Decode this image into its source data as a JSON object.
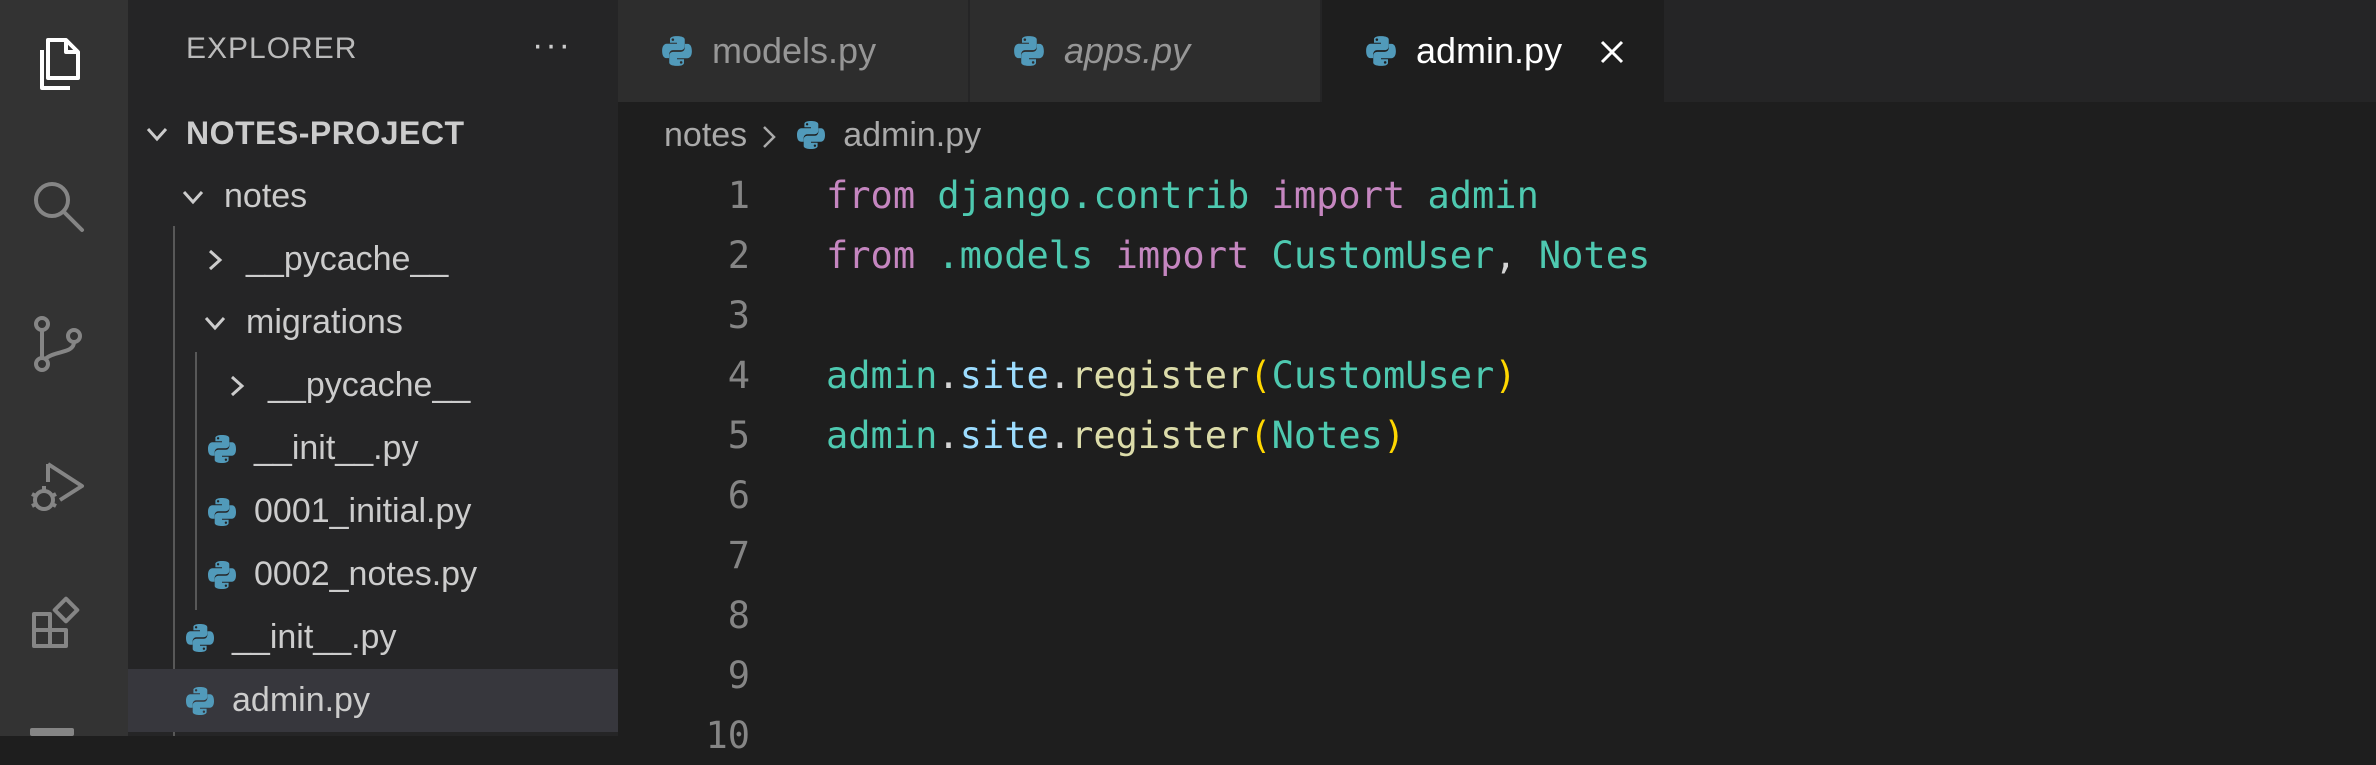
{
  "explorer": {
    "header": "EXPLORER",
    "more": "···",
    "project": "NOTES-PROJECT",
    "tree": [
      {
        "label": "notes",
        "type": "folder",
        "open": true,
        "depth": 1
      },
      {
        "label": "__pycache__",
        "type": "folder",
        "open": false,
        "depth": 2
      },
      {
        "label": "migrations",
        "type": "folder",
        "open": true,
        "depth": 2
      },
      {
        "label": "__pycache__",
        "type": "folder",
        "open": false,
        "depth": 3
      },
      {
        "label": "__init__.py",
        "type": "py",
        "depth": 3
      },
      {
        "label": "0001_initial.py",
        "type": "py",
        "depth": 3
      },
      {
        "label": "0002_notes.py",
        "type": "py",
        "depth": 3
      },
      {
        "label": "__init__.py",
        "type": "py",
        "depth": 2
      },
      {
        "label": "admin.py",
        "type": "py",
        "depth": 2,
        "selected": true
      }
    ]
  },
  "tabs": [
    {
      "label": "models.py",
      "active": false,
      "italic": false
    },
    {
      "label": "apps.py",
      "active": false,
      "italic": true
    },
    {
      "label": "admin.py",
      "active": true,
      "italic": false
    }
  ],
  "breadcrumb": {
    "folder": "notes",
    "file": "admin.py"
  },
  "code": {
    "line_numbers": [
      "1",
      "2",
      "3",
      "4",
      "5",
      "6",
      "7",
      "8",
      "9",
      "10"
    ],
    "lines": [
      [
        {
          "t": "from",
          "c": "kw"
        },
        {
          "t": " ",
          "c": "punct"
        },
        {
          "t": "django.contrib",
          "c": "mod"
        },
        {
          "t": " ",
          "c": "punct"
        },
        {
          "t": "import",
          "c": "kw"
        },
        {
          "t": " ",
          "c": "punct"
        },
        {
          "t": "admin",
          "c": "mod"
        }
      ],
      [
        {
          "t": "from",
          "c": "kw"
        },
        {
          "t": " ",
          "c": "punct"
        },
        {
          "t": ".models",
          "c": "mod"
        },
        {
          "t": " ",
          "c": "punct"
        },
        {
          "t": "import",
          "c": "kw"
        },
        {
          "t": " ",
          "c": "punct"
        },
        {
          "t": "CustomUser",
          "c": "var"
        },
        {
          "t": ", ",
          "c": "punct"
        },
        {
          "t": "Notes",
          "c": "var"
        }
      ],
      [],
      [
        {
          "t": "admin",
          "c": "var"
        },
        {
          "t": ".",
          "c": "punct"
        },
        {
          "t": "site",
          "c": "prop"
        },
        {
          "t": ".",
          "c": "punct"
        },
        {
          "t": "register",
          "c": "fn"
        },
        {
          "t": "(",
          "c": "paren"
        },
        {
          "t": "CustomUser",
          "c": "var"
        },
        {
          "t": ")",
          "c": "paren"
        }
      ],
      [
        {
          "t": "admin",
          "c": "var"
        },
        {
          "t": ".",
          "c": "punct"
        },
        {
          "t": "site",
          "c": "prop"
        },
        {
          "t": ".",
          "c": "punct"
        },
        {
          "t": "register",
          "c": "fn"
        },
        {
          "t": "(",
          "c": "paren"
        },
        {
          "t": "Notes",
          "c": "var"
        },
        {
          "t": ")",
          "c": "paren"
        }
      ],
      [],
      [],
      [],
      [],
      []
    ]
  },
  "colors": {
    "activity_bar": "#333333",
    "sidebar": "#252526",
    "editor": "#1e1e1e",
    "keyword": "#c586c0",
    "module": "#4ec9b0",
    "function": "#dcdcaa",
    "property": "#9cdcfe",
    "bracket": "#ffd700"
  },
  "icons": {
    "activity": [
      "files-icon",
      "search-icon",
      "source-control-icon",
      "run-debug-icon",
      "extensions-icon"
    ]
  }
}
